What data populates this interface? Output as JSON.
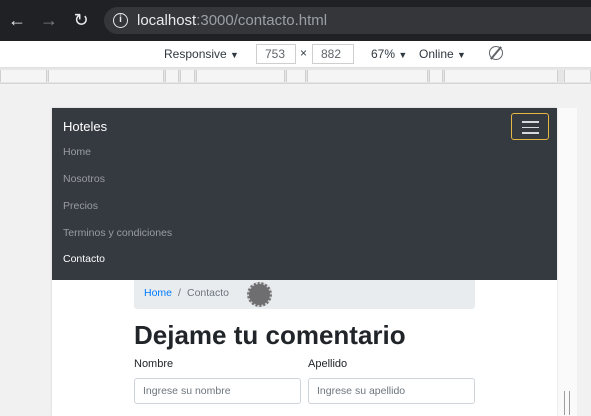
{
  "browser": {
    "url_host": "localhost",
    "url_rest": ":3000/contacto.html",
    "icons": {
      "back": "arrow-left",
      "forward": "arrow-right",
      "reload": "reload",
      "info": "info"
    }
  },
  "device_toolbar": {
    "device": "Responsive",
    "width": "753",
    "times": "×",
    "height": "882",
    "zoom": "67%",
    "network": "Online",
    "caret": "▼"
  },
  "navbar": {
    "brand": "Hoteles",
    "links": [
      "Home",
      "Nosotros",
      "Precios",
      "Terminos y condiciones",
      "Contacto"
    ],
    "active_index": 4
  },
  "breadcrumb": {
    "home": "Home",
    "separator": "/",
    "current": "Contacto"
  },
  "form": {
    "heading": "Dejame tu comentario",
    "nombre_label": "Nombre",
    "nombre_placeholder": "Ingrese su nombre",
    "apellido_label": "Apellido",
    "apellido_placeholder": "Ingrese su apellido"
  },
  "colors": {
    "navbar_bg": "#343a40",
    "link": "#007bff",
    "toggler_focus": "#e6b843"
  }
}
